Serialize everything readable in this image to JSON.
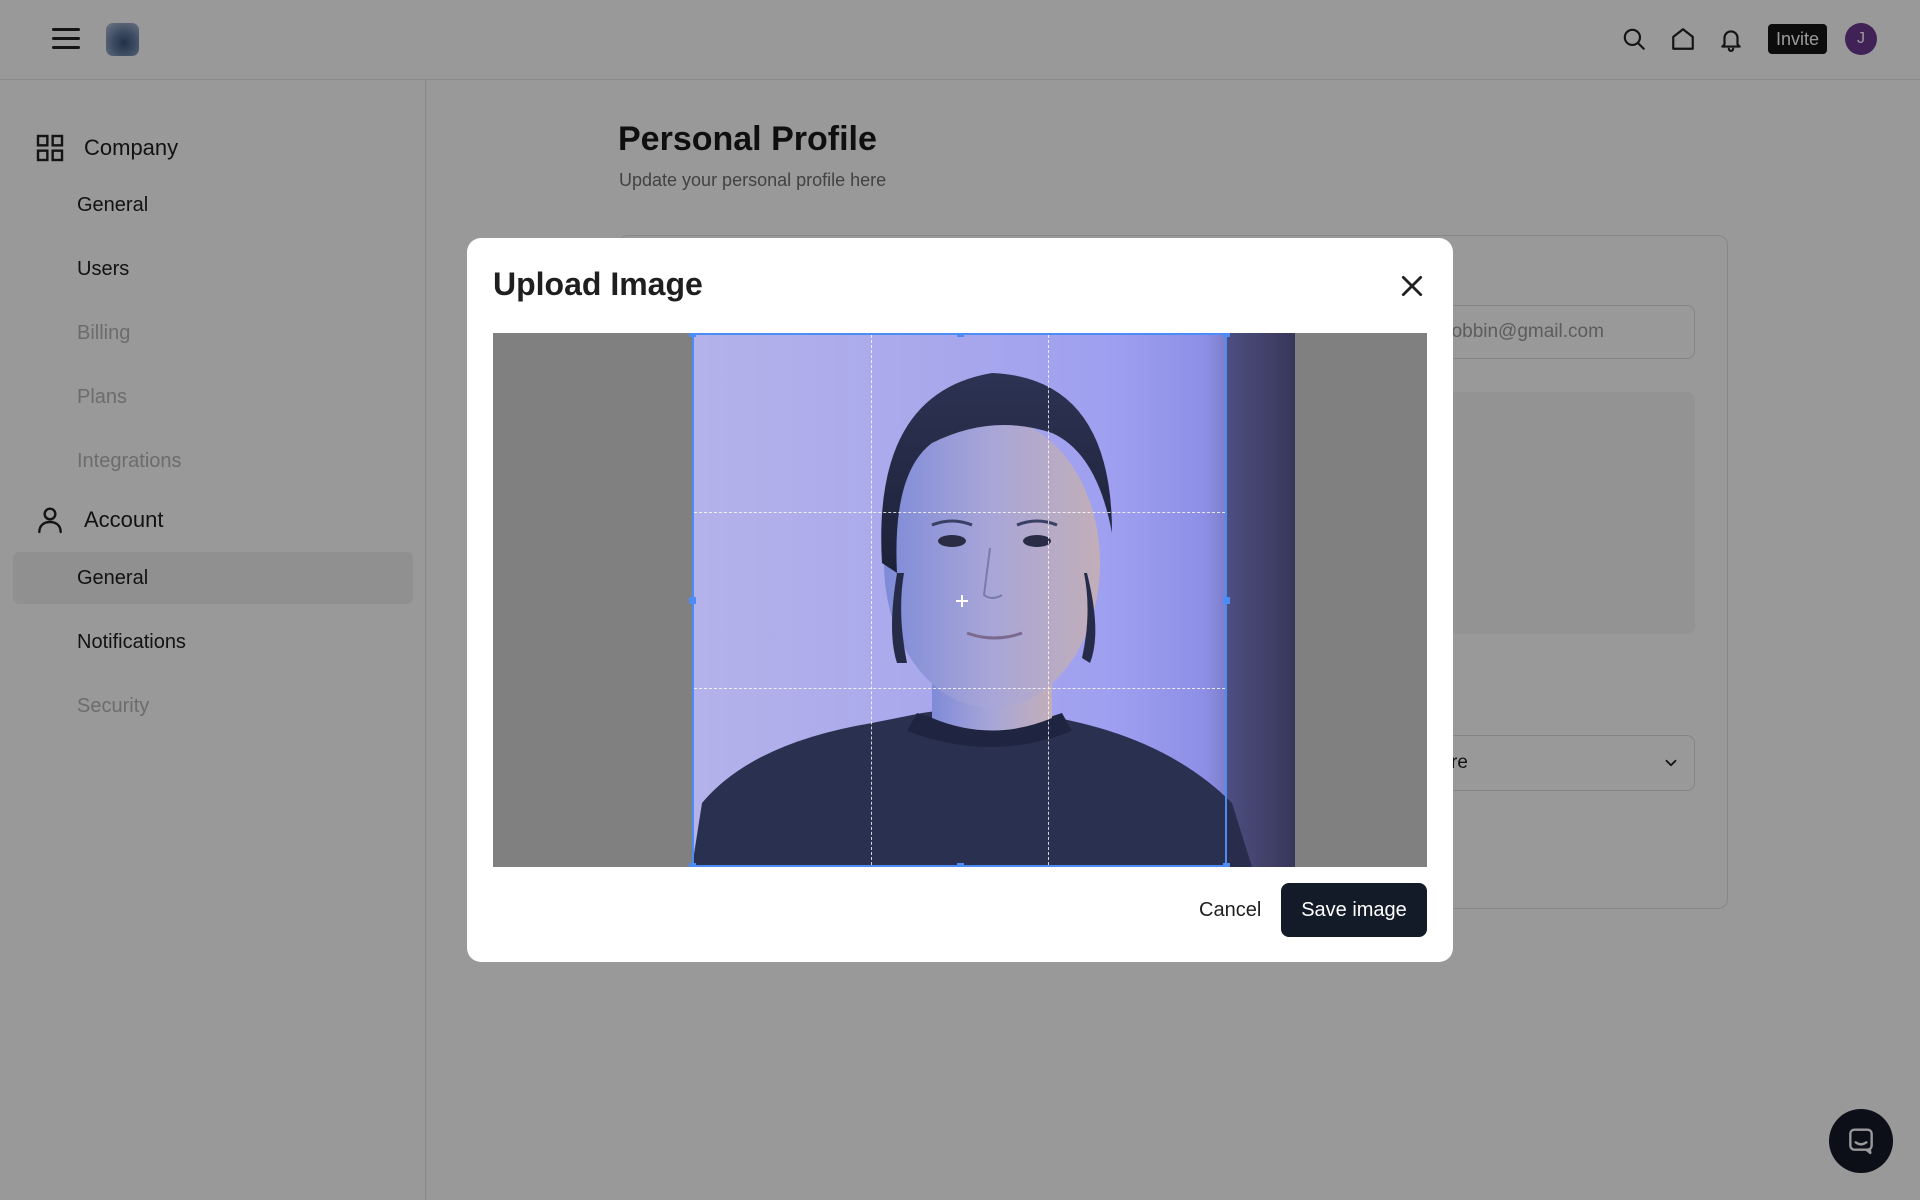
{
  "header": {
    "invite_label": "Invite",
    "avatar_initial": "J"
  },
  "sidebar": {
    "company_label": "Company",
    "company_items": [
      {
        "label": "General"
      },
      {
        "label": "Users"
      },
      {
        "label": "Billing"
      },
      {
        "label": "Plans"
      },
      {
        "label": "Integrations"
      }
    ],
    "account_label": "Account",
    "account_items": [
      {
        "label": "General"
      },
      {
        "label": "Notifications"
      },
      {
        "label": "Security"
      }
    ]
  },
  "main": {
    "title": "Personal Profile",
    "subtitle": "Update your personal profile here",
    "email_value": "hobbin@gmail.com",
    "select_value": "re"
  },
  "modal": {
    "title": "Upload Image",
    "cancel_label": "Cancel",
    "save_label": "Save image"
  },
  "colors": {
    "accent": "#4e8cf5",
    "primary_button": "#131a28",
    "avatar": "#6b3a8f"
  }
}
